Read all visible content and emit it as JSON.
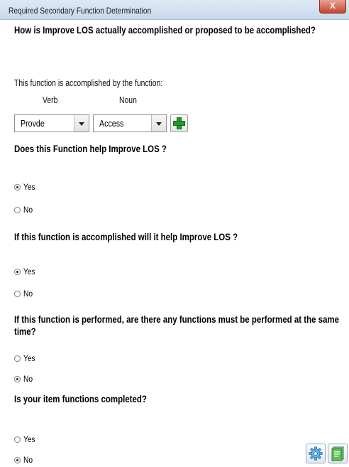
{
  "window": {
    "title": "Required Secondary Function Determination",
    "close_label": "X"
  },
  "questions": {
    "q1": "How is Improve LOS actually accomplished or proposed to be accomplished?",
    "q2": "Does this Function help Improve LOS ?",
    "q3": "If this function is accomplished will it help Improve LOS ?",
    "q4": "If this function is performed, are there any functions must be performed at the same time?",
    "q5": "Is your item functions completed?"
  },
  "accomplished_by": {
    "label": "This function is accomplished by the function:",
    "verb_header": "Verb",
    "noun_header": "Noun",
    "verb_value": "Provde",
    "noun_value": "Access"
  },
  "radios": {
    "q2": {
      "yes": "Yes",
      "no": "No",
      "selected": "yes"
    },
    "q3": {
      "yes": "Yes",
      "no": "No",
      "selected": "yes"
    },
    "q4": {
      "yes": "Yes",
      "no": "No",
      "selected": "no"
    },
    "q5": {
      "yes": "Yes",
      "no": "No",
      "selected": "no"
    }
  },
  "icons": {
    "add": "plus-icon",
    "settings": "gear-icon",
    "report": "document-icon"
  },
  "colors": {
    "add_green": "#1f9d2b",
    "close_red": "#c4452c"
  }
}
